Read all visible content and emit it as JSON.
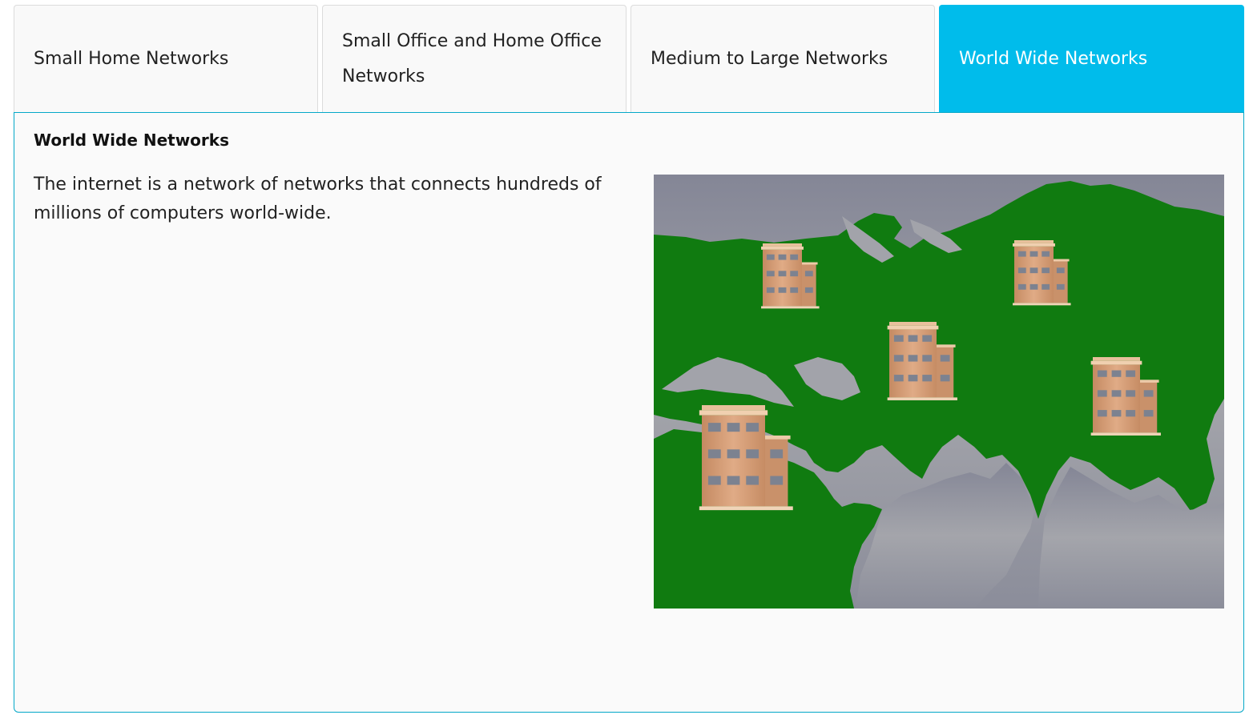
{
  "tabs": [
    {
      "label": "Small Home Networks",
      "active": false
    },
    {
      "label": "Small Office and Home Office Networks",
      "active": false
    },
    {
      "label": "Medium to Large Networks",
      "active": false
    },
    {
      "label": "World Wide Networks",
      "active": true
    }
  ],
  "panel": {
    "title": "World Wide Networks",
    "text": "The internet is a network of networks that connects hundreds of millions of computers world-wide."
  },
  "map": {
    "land_color": "#107b10",
    "sea_color": "#9a9ca6",
    "building_color": "#d8a07a",
    "building_count": 5
  },
  "colors": {
    "accent": "#00bceb",
    "panel_border": "#04a8c8"
  }
}
